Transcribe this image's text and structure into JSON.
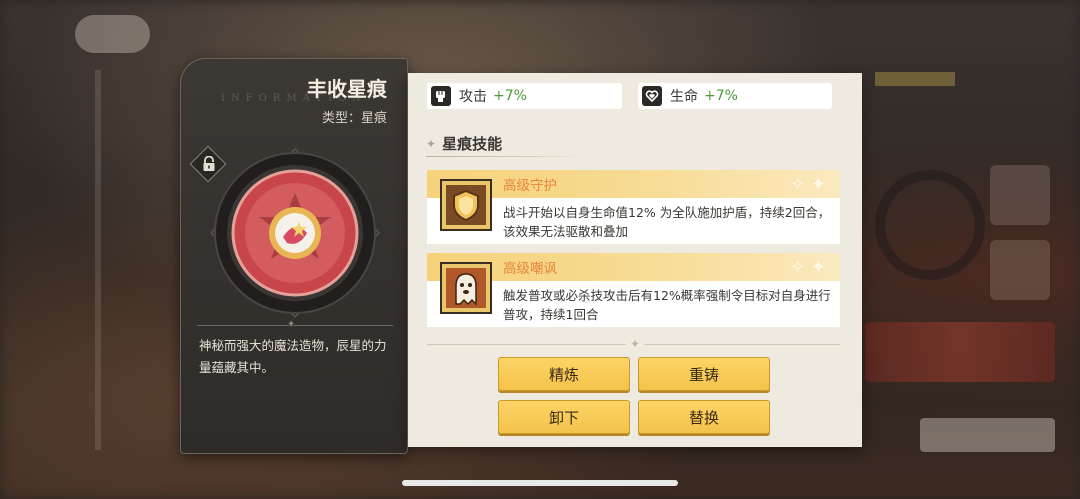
{
  "item": {
    "title": "丰收星痕",
    "type_label": "类型：星痕",
    "watermark": "INFORMATION",
    "description": "神秘而强大的魔法造物，辰星的力量蕴藏其中。"
  },
  "stats": [
    {
      "label": "攻击",
      "value": "+7%",
      "icon": "fist-icon"
    },
    {
      "label": "生命",
      "value": "+7%",
      "icon": "heart-icon"
    }
  ],
  "skills_section": {
    "title": "星痕技能",
    "skills": [
      {
        "name": "高级守护",
        "text": "战斗开始以自身生命值12% 为全队施加护盾，持续2回合，该效果无法驱散和叠加",
        "icon": "shield-skill-icon"
      },
      {
        "name": "高级嘲讽",
        "text": "触发普攻或必杀技攻击后有12%概率强制令目标对自身进行普攻，持续1回合",
        "icon": "ghost-skill-icon"
      }
    ]
  },
  "actions": {
    "refine": "精炼",
    "recast": "重铸",
    "unequip": "卸下",
    "replace": "替换"
  },
  "colors": {
    "stat_positive": "#4b9a3a",
    "skill_name": "#e9853c",
    "button": "#f4c24a"
  }
}
